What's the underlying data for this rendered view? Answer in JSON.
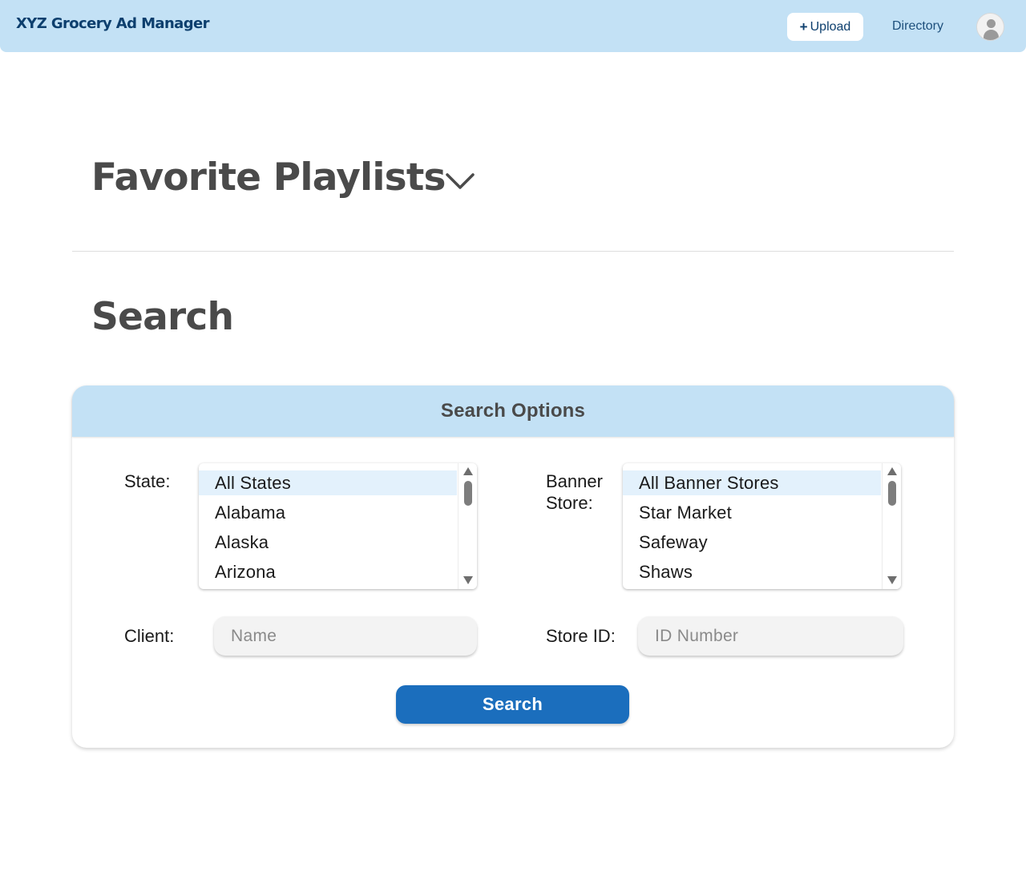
{
  "header": {
    "brand": "XYZ Grocery Ad Manager",
    "upload_icon": "+",
    "upload_label": "Upload",
    "directory_label": "Directory",
    "avatar_icon": "user-avatar-icon"
  },
  "favorites": {
    "title": "Favorite Playlists",
    "toggle_icon": "chevron-down-icon"
  },
  "search": {
    "title": "Search",
    "panel_title": "Search Options",
    "state": {
      "label": "State:",
      "selected": "All States",
      "options": [
        "All States",
        "Alabama",
        "Alaska",
        "Arizona"
      ]
    },
    "banner_store": {
      "label_line1": "Banner",
      "label_line2": "Store:",
      "selected": "All Banner Stores",
      "options": [
        "All Banner Stores",
        "Star Market",
        "Safeway",
        "Shaws"
      ]
    },
    "client": {
      "label": "Client:",
      "value": "",
      "placeholder": "Name"
    },
    "store_id": {
      "label": "Store ID:",
      "value": "",
      "placeholder": "ID Number"
    },
    "submit_label": "Search"
  },
  "colors": {
    "header_bg": "#c3e1f5",
    "brand_text": "#0d3f6e",
    "primary_button": "#1b6ebd",
    "selected_option_bg": "#e3f1fc",
    "heading_text": "#4a4a4a"
  }
}
